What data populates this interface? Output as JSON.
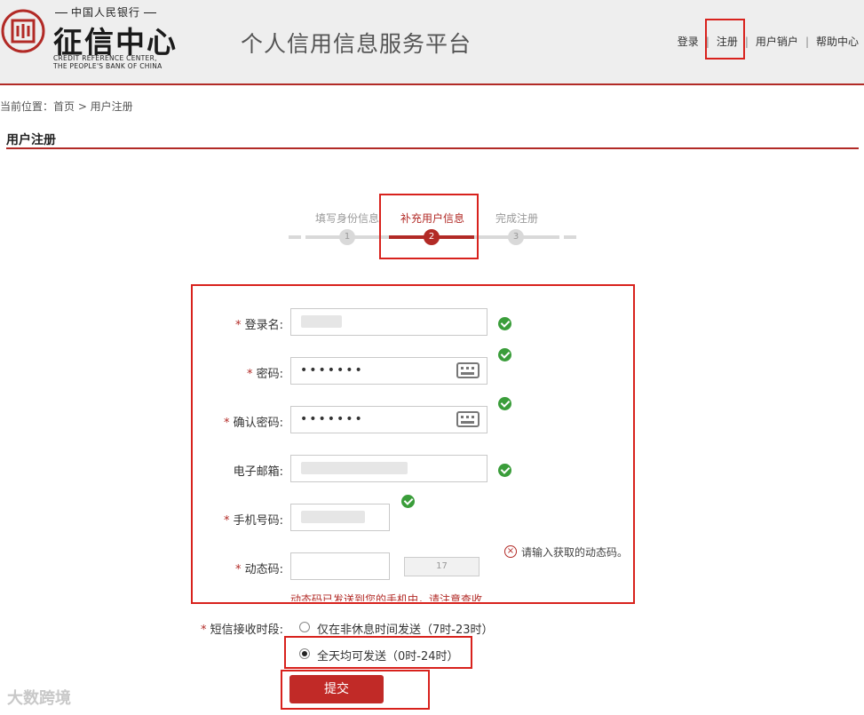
{
  "header": {
    "logo_top": "中国人民银行",
    "logo_main": "征信中心",
    "logo_en1": "CREDIT REFERENCE  CENTER,",
    "logo_en2": "THE PEOPLE'S BANK OF CHINA",
    "platform_title": "个人信用信息服务平台",
    "nav": {
      "login": "登录",
      "register": "注册",
      "cancel_account": "用户销户",
      "help": "帮助中心",
      "separator": "|"
    }
  },
  "breadcrumb": "当前位置：首页 > 用户注册",
  "page_title": "用户注册",
  "steps": [
    {
      "label": "填写身份信息",
      "number": "1",
      "active": false
    },
    {
      "label": "补充用户信息",
      "number": "2",
      "active": true
    },
    {
      "label": "完成注册",
      "number": "3",
      "active": false
    }
  ],
  "form": {
    "required_mark": "*",
    "login_name_label": "登录名:",
    "password_label": "密码:",
    "password_value": "•••••••",
    "confirm_password_label": "确认密码:",
    "confirm_password_value": "•••••••",
    "email_label": "电子邮箱:",
    "phone_label": "手机号码:",
    "code_label": "动态码:",
    "code_button": "17",
    "code_error": "请输入获取的动态码。",
    "code_hint": "动态码已发送到您的手机中，请注意查收",
    "sms_time_label": "短信接收时段:",
    "sms_option_1": "仅在非休息时间发送（7时-23时）",
    "sms_option_2": "全天均可发送（0时-24时）",
    "submit": "提交"
  },
  "watermark": "大数跨境",
  "colors": {
    "accent": "#b22a26",
    "success": "#3a9d3a",
    "annotation": "#d8221d"
  }
}
